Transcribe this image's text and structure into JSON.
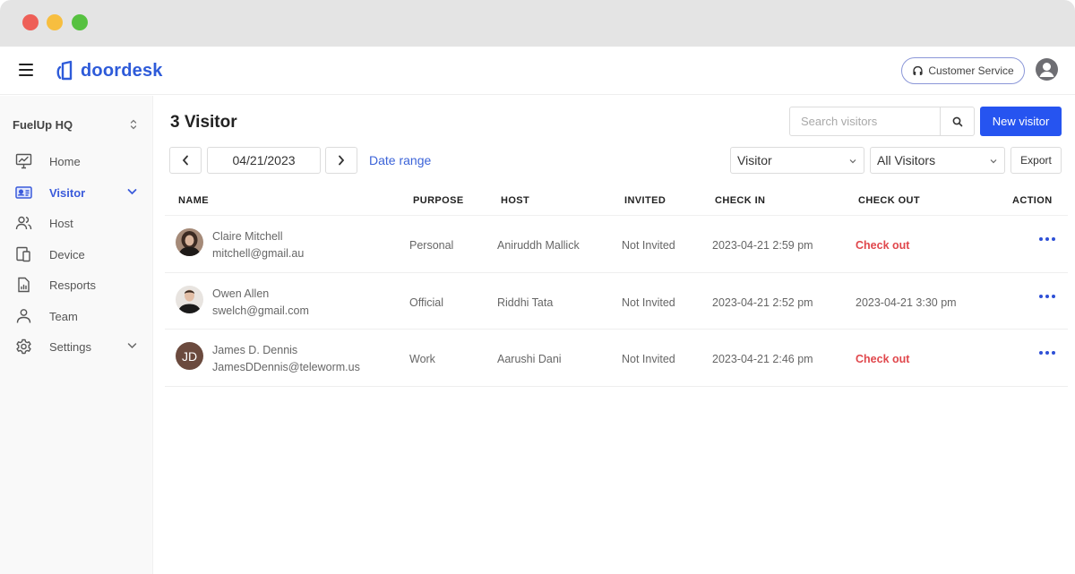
{
  "window": {
    "controls": [
      "close",
      "minimize",
      "maximize"
    ]
  },
  "topnav": {
    "menu_icon": "hamburger-icon",
    "logo_text": "doordesk",
    "customer_service_label": "Customer Service",
    "customer_service_icon": "headset-icon",
    "profile_icon": "user-circle-icon"
  },
  "sidebar": {
    "org_name": "FuelUp HQ",
    "items": [
      {
        "label": "Home",
        "icon": "monitor-chart-icon",
        "active": false,
        "has_chevron": false
      },
      {
        "label": "Visitor",
        "icon": "id-card-icon",
        "active": true,
        "has_chevron": true
      },
      {
        "label": "Host",
        "icon": "users-icon",
        "active": false,
        "has_chevron": false
      },
      {
        "label": "Device",
        "icon": "devices-icon",
        "active": false,
        "has_chevron": false
      },
      {
        "label": "Resports",
        "icon": "report-icon",
        "active": false,
        "has_chevron": false
      },
      {
        "label": "Team",
        "icon": "user-icon",
        "active": false,
        "has_chevron": false
      },
      {
        "label": "Settings",
        "icon": "gear-icon",
        "active": false,
        "has_chevron": true
      }
    ]
  },
  "main": {
    "title": "3 Visitor",
    "search": {
      "placeholder": "Search visitors",
      "value": ""
    },
    "new_visitor_label": "New visitor",
    "date": "04/21/2023",
    "date_range_label": "Date range",
    "filter_type": "Visitor",
    "filter_scope": "All Visitors",
    "export_label": "Export",
    "colors": {
      "accent": "#2654f0",
      "link": "#3b63d8",
      "danger": "#e0474c"
    }
  },
  "table": {
    "columns": [
      "NAME",
      "PURPOSE",
      "HOST",
      "INVITED",
      "CHECK IN",
      "CHECK OUT",
      "ACTION"
    ],
    "rows": [
      {
        "name": "Claire Mitchell",
        "email": "mitchell@gmail.au",
        "avatar": "photo",
        "purpose": "Personal",
        "host": "Aniruddh Mallick",
        "invited": "Not Invited",
        "check_in": "2023-04-21 2:59 pm",
        "check_out": "Check out",
        "check_out_is_action": true
      },
      {
        "name": "Owen Allen",
        "email": "swelch@gmail.com",
        "avatar": "photo",
        "purpose": "Official",
        "host": "Riddhi Tata",
        "invited": "Not Invited",
        "check_in": "2023-04-21 2:52 pm",
        "check_out": "2023-04-21 3:30 pm",
        "check_out_is_action": false
      },
      {
        "name": "James D. Dennis",
        "email": "JamesDDennis@teleworm.us",
        "avatar": "JD",
        "purpose": "Work",
        "host": "Aarushi Dani",
        "invited": "Not Invited",
        "check_in": "2023-04-21 2:46 pm",
        "check_out": "Check out",
        "check_out_is_action": true
      }
    ]
  }
}
